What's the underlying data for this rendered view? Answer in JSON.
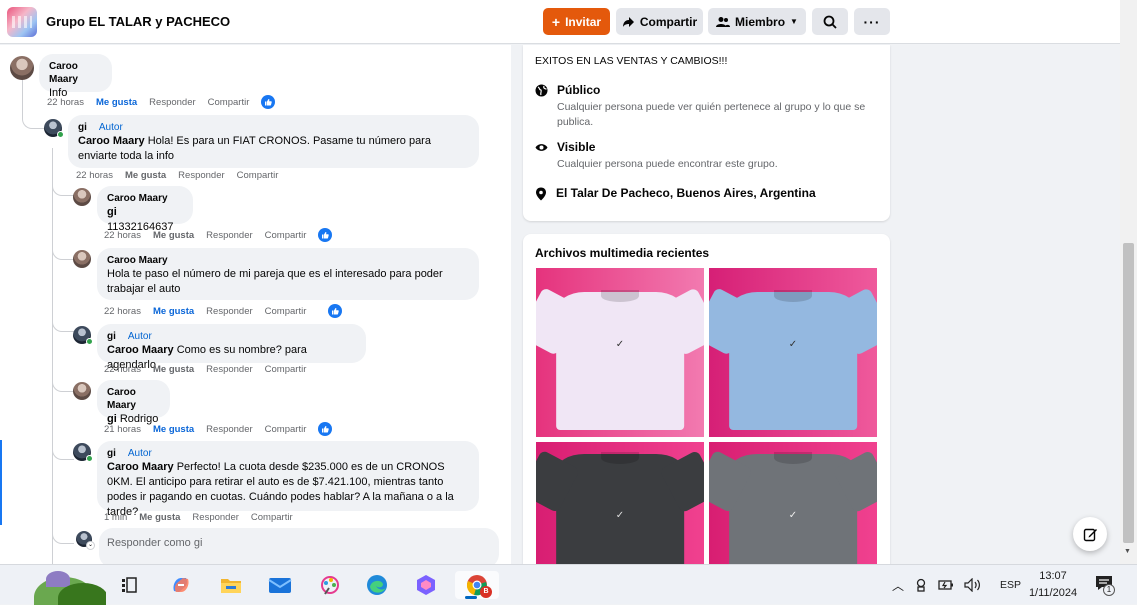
{
  "header": {
    "group_name": "Grupo EL TALAR y PACHECO",
    "invite_label": "Invitar",
    "share_label": "Compartir",
    "member_label": "Miembro"
  },
  "comments": [
    {
      "author": "Caroo Maary",
      "text": "Info",
      "time": "22 horas",
      "like": "Me gusta",
      "reply": "Responder",
      "share": "Compartir",
      "liked": true
    },
    {
      "author": "gi",
      "badge": "Autor",
      "mention": "Caroo Maary",
      "text": " Hola! Es para un FIAT CRONOS. Pasame tu número para enviarte toda la info",
      "time": "22 horas",
      "like": "Me gusta",
      "reply": "Responder",
      "share": "Compartir"
    },
    {
      "author": "Caroo Maary",
      "mention": "gi",
      "text": " 11332164637",
      "time": "22 horas",
      "like": "Me gusta",
      "reply": "Responder",
      "share": "Compartir",
      "liked": true
    },
    {
      "author": "Caroo Maary",
      "text": "Hola te paso el número de mi pareja que es el interesado para poder trabajar el auto",
      "time": "22 horas",
      "like": "Me gusta",
      "reply": "Responder",
      "share": "Compartir",
      "liked": true
    },
    {
      "author": "gi",
      "badge": "Autor",
      "mention": "Caroo Maary",
      "text": " Como es su nombre? para agendarlo",
      "time": "22 horas",
      "like": "Me gusta",
      "reply": "Responder",
      "share": "Compartir"
    },
    {
      "author": "Caroo Maary",
      "mention": "gi",
      "text": " Rodrigo",
      "time": "21 horas",
      "like": "Me gusta",
      "reply": "Responder",
      "share": "Compartir",
      "liked": true
    },
    {
      "author": "gi",
      "badge": "Autor",
      "mention": "Caroo Maary",
      "text": " Perfecto! La cuota desde $235.000 es de un CRONOS 0KM. El anticipo para retirar el auto es de $7.421.100, mientras tanto podes ir pagando en cuotas. Cuándo podes hablar? A la mañana o a la tarde?",
      "time": "1 min",
      "like": "Me gusta",
      "reply": "Responder",
      "share": "Compartir"
    }
  ],
  "reply_placeholder": "Responder como gi",
  "about": {
    "tagline": "EXITOS EN LAS VENTAS Y CAMBIOS!!!",
    "public_title": "Público",
    "public_desc": "Cualquier persona puede ver quién pertenece al grupo y lo que se publica.",
    "visible_title": "Visible",
    "visible_desc": "Cualquier persona puede encontrar este grupo.",
    "location": "El Talar De Pacheco, Buenos Aires, Argentina"
  },
  "media": {
    "title": "Archivos multimedia recientes",
    "items": [
      {
        "icon": "white-shirt"
      },
      {
        "icon": "light-blue-shirt"
      },
      {
        "icon": "dark-grey-shirt"
      },
      {
        "icon": "grey-shirt"
      }
    ]
  },
  "taskbar": {
    "language": "ESP",
    "time": "13:07",
    "date": "1/11/2024",
    "notification_count": "1",
    "chrome_badge": "B"
  },
  "colors": {
    "accent": "#e4590c",
    "link": "#0064d1",
    "like_blue": "#1877f2",
    "media_bg": "#e0287f"
  }
}
